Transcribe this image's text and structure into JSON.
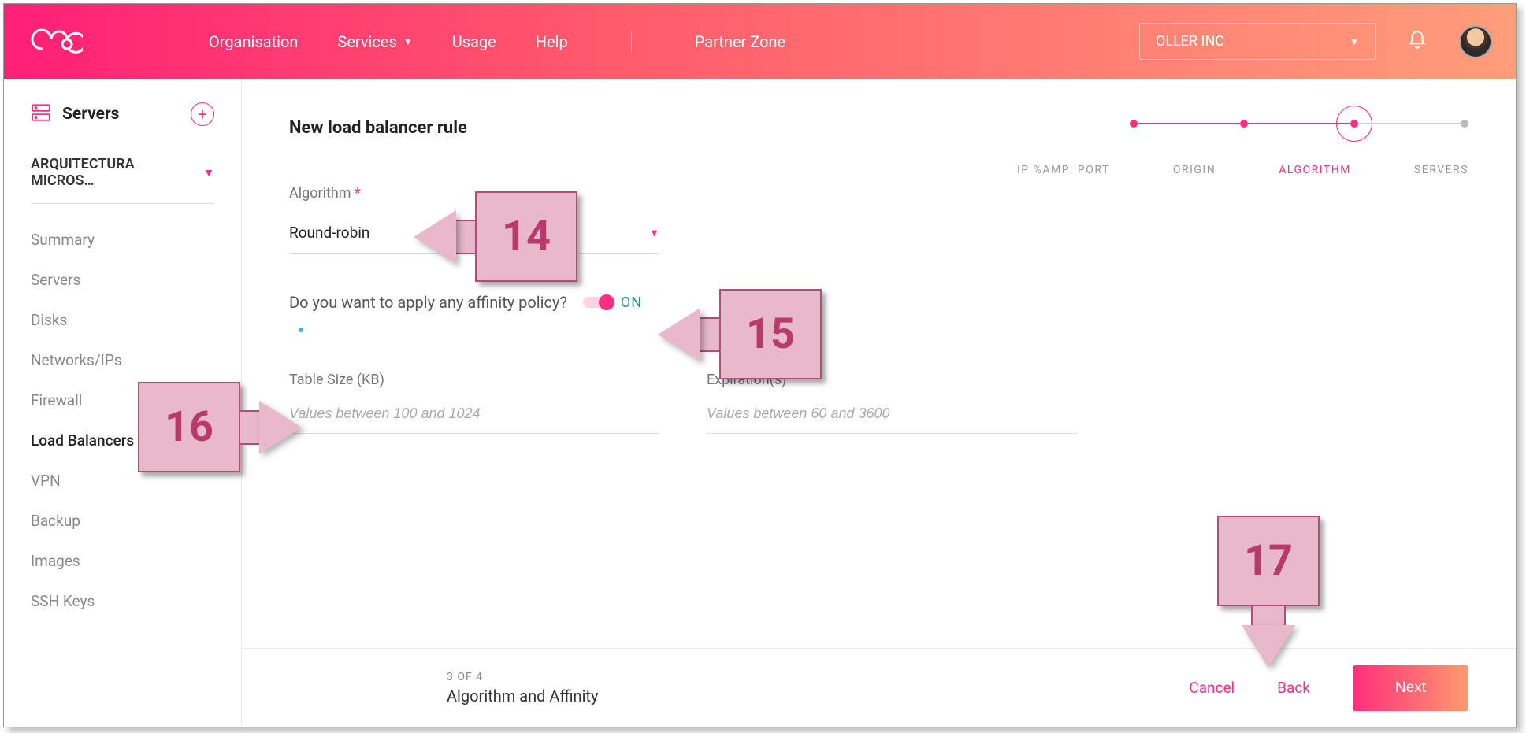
{
  "header": {
    "nav": {
      "organisation": "Organisation",
      "services": "Services",
      "usage": "Usage",
      "help": "Help",
      "partner": "Partner Zone"
    },
    "org_selector": "OLLER INC"
  },
  "sidebar": {
    "title": "Servers",
    "arch_selector": "ARQUITECTURA MICROS…",
    "items": [
      {
        "label": "Summary"
      },
      {
        "label": "Servers"
      },
      {
        "label": "Disks"
      },
      {
        "label": "Networks/IPs"
      },
      {
        "label": "Firewall"
      },
      {
        "label": "Load Balancers",
        "active": true
      },
      {
        "label": "VPN"
      },
      {
        "label": "Backup"
      },
      {
        "label": "Images"
      },
      {
        "label": "SSH Keys"
      }
    ]
  },
  "main": {
    "title": "New load balancer rule",
    "stepper": {
      "steps": [
        "IP %AMP: PORT",
        "ORIGIN",
        "ALGORITHM",
        "SERVERS"
      ],
      "current_index": 2
    },
    "form": {
      "algorithm_label": "Algorithm",
      "algorithm_value": "Round-robin",
      "affinity_question": "Do you want to apply any affinity policy?",
      "toggle_state": "ON",
      "table_size_label": "Table Size (KB)",
      "table_size_placeholder": "Values between 100 and 1024",
      "expiration_label": "Expiration(s)",
      "expiration_placeholder": "Values between 60 and 3600"
    }
  },
  "footer": {
    "step_count": "3 OF 4",
    "step_name": "Algorithm and Affinity",
    "cancel": "Cancel",
    "back": "Back",
    "next": "Next"
  },
  "annotations": {
    "a14": "14",
    "a15": "15",
    "a16": "16",
    "a17": "17"
  }
}
